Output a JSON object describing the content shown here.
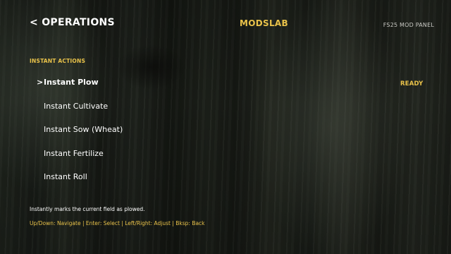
{
  "header": {
    "back_label": "< OPERATIONS",
    "brand": "MODSLAB",
    "panel_label": "FS25 MOD PANEL"
  },
  "section": {
    "label": "INSTANT ACTIONS"
  },
  "menu": {
    "cursor": ">",
    "selected_index": 0,
    "items": [
      {
        "label": "Instant Plow"
      },
      {
        "label": "Instant Cultivate"
      },
      {
        "label": "Instant Sow (Wheat)"
      },
      {
        "label": "Instant Fertilize"
      },
      {
        "label": "Instant Roll"
      }
    ]
  },
  "status": {
    "text": "READY"
  },
  "footer": {
    "description": "Instantly marks the current field as plowed.",
    "hints": "Up/Down: Navigate | Enter: Select | Left/Right: Adjust | Bksp: Back"
  },
  "colors": {
    "accent": "#e9c24a",
    "text": "#ffffff",
    "muted": "#c9c9c4"
  }
}
